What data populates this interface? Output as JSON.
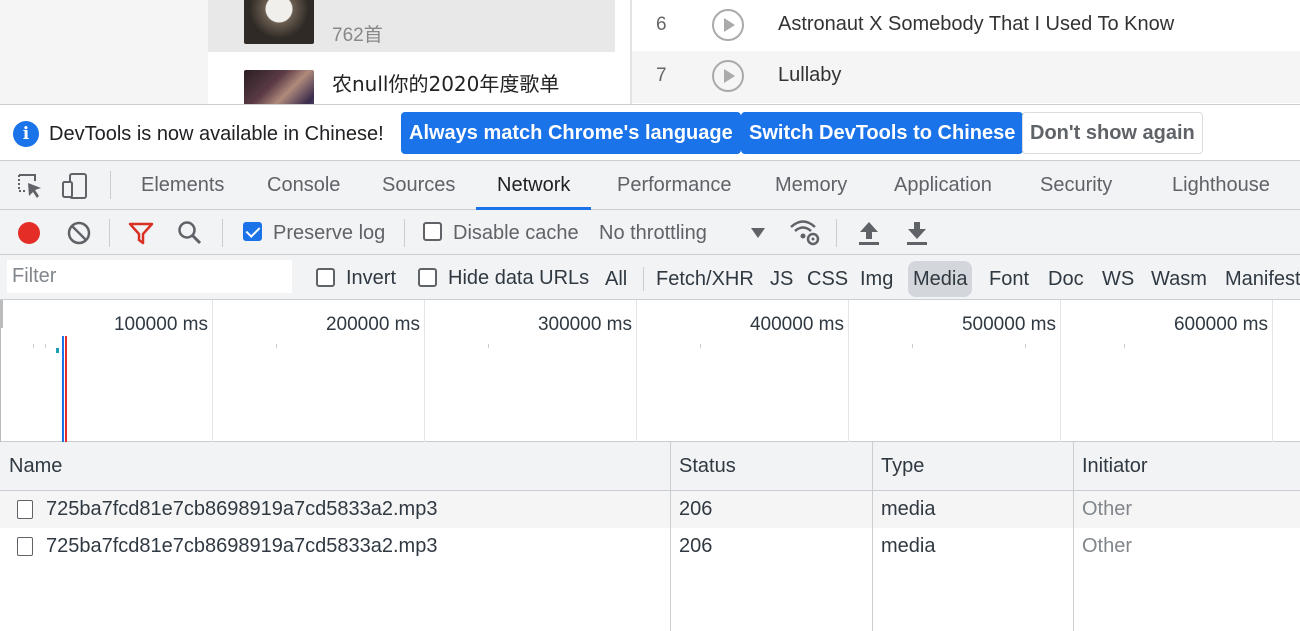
{
  "page": {
    "playlists": [
      {
        "count": "762首"
      },
      {
        "title": "农null你的2020年度歌单"
      }
    ],
    "songs": [
      {
        "num": "6",
        "title": "Astronaut X Somebody That I Used To Know"
      },
      {
        "num": "7",
        "title": "Lullaby"
      }
    ]
  },
  "devtools": {
    "infobar": {
      "message": "DevTools is now available in Chinese!",
      "btn_match": "Always match Chrome's language",
      "btn_switch": "Switch DevTools to Chinese",
      "btn_dismiss": "Don't show again"
    },
    "tabs": [
      "Elements",
      "Console",
      "Sources",
      "Network",
      "Performance",
      "Memory",
      "Application",
      "Security",
      "Lighthouse"
    ],
    "active_tab": "Network",
    "toolbar": {
      "preserve_log": "Preserve log",
      "disable_cache": "Disable cache",
      "throttling": "No throttling"
    },
    "filterbar": {
      "filter_placeholder": "Filter",
      "invert": "Invert",
      "hide_data_urls": "Hide data URLs",
      "types": [
        "All",
        "Fetch/XHR",
        "JS",
        "CSS",
        "Img",
        "Media",
        "Font",
        "Doc",
        "WS",
        "Wasm",
        "Manifest"
      ],
      "active_type": "Media"
    },
    "overview": {
      "labels": [
        "100000 ms",
        "200000 ms",
        "300000 ms",
        "400000 ms",
        "500000 ms",
        "600000 ms"
      ]
    },
    "table": {
      "headers": [
        "Name",
        "Status",
        "Type",
        "Initiator"
      ],
      "rows": [
        {
          "name": "725ba7fcd81e7cb8698919a7cd5833a2.mp3",
          "status": "206",
          "type": "media",
          "initiator": "Other"
        },
        {
          "name": "725ba7fcd81e7cb8698919a7cd5833a2.mp3",
          "status": "206",
          "type": "media",
          "initiator": "Other"
        }
      ]
    },
    "colors": {
      "accent": "#1a73e8",
      "record": "#e52d27",
      "filter_icon": "#d93025"
    }
  }
}
